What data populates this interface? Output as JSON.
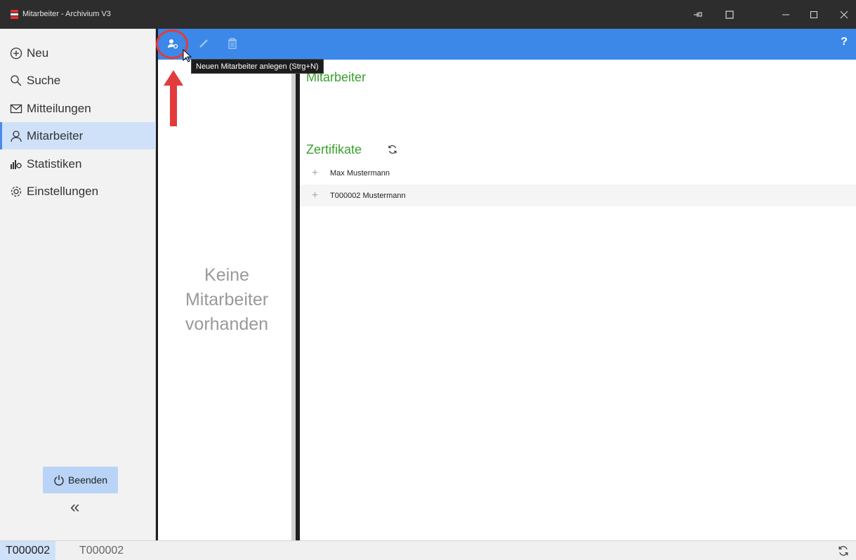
{
  "window": {
    "title": "Mitarbeiter - Archivium V3",
    "controls": [
      "minimize",
      "maximize",
      "close"
    ]
  },
  "sidebar": {
    "items": [
      {
        "label": "Neu",
        "icon": "plus-circle-icon"
      },
      {
        "label": "Suche",
        "icon": "search-icon"
      },
      {
        "label": "Mitteilungen",
        "icon": "mail-icon"
      },
      {
        "label": "Mitarbeiter",
        "icon": "person-icon",
        "active": true
      },
      {
        "label": "Statistiken",
        "icon": "statistics-icon"
      },
      {
        "label": "Einstellungen",
        "icon": "gear-icon"
      }
    ],
    "exit_label": "Beenden",
    "collapse_glyph": "«"
  },
  "toolbar": {
    "help_label": "?",
    "tooltip": "Neuen Mitarbeiter anlegen (Strg+N)",
    "accent": "#3c88e8"
  },
  "list": {
    "empty_message": [
      "Keine",
      "Mitarbeiter",
      "vorhanden"
    ]
  },
  "details": {
    "section_title": "Mitarbeiter",
    "certificates_title": "Zertifikate",
    "certificates": [
      {
        "name": "Max Mustermann"
      },
      {
        "name": "T000002 Mustermann"
      }
    ],
    "accent": "#3aa02f"
  },
  "statusbar": {
    "active_tab": "T000002",
    "other_tab": "T000002"
  }
}
